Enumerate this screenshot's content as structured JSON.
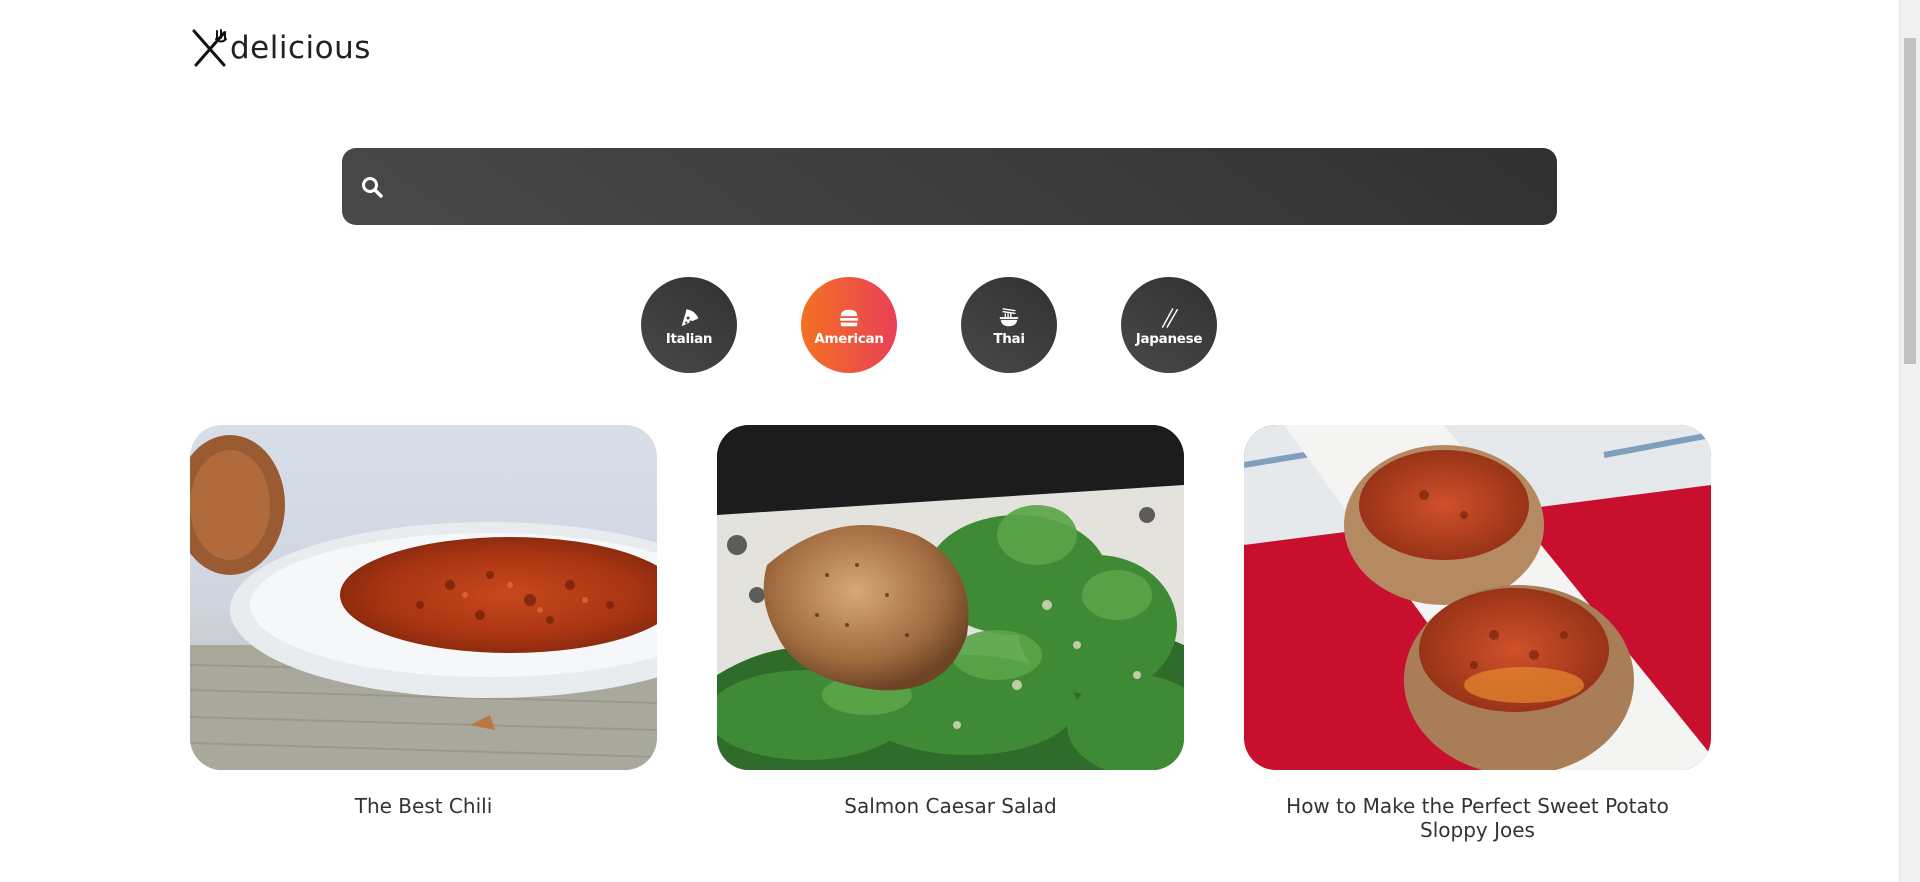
{
  "logo": {
    "text": "delicious",
    "icon": "fork-knife-icon"
  },
  "search": {
    "value": "",
    "placeholder": "",
    "icon": "search-icon"
  },
  "categories": [
    {
      "label": "Italian",
      "icon": "pizza-icon",
      "active": false
    },
    {
      "label": "American",
      "icon": "burger-icon",
      "active": true
    },
    {
      "label": "Thai",
      "icon": "noodle-bowl-icon",
      "active": false
    },
    {
      "label": "Japanese",
      "icon": "chopsticks-icon",
      "active": false
    }
  ],
  "recipes": [
    {
      "title": "The Best Chili",
      "image": "chili-bowl-photo"
    },
    {
      "title": "Salmon Caesar Salad",
      "image": "salmon-caesar-salad-photo"
    },
    {
      "title": "How to Make the Perfect Sweet Potato Sloppy Joes",
      "image": "sweet-potato-sloppy-joes-photo"
    }
  ],
  "colors": {
    "dark_gradient_start": "#494949",
    "dark_gradient_end": "#313131",
    "active_gradient_start": "#f27121",
    "active_gradient_end": "#e94057"
  }
}
